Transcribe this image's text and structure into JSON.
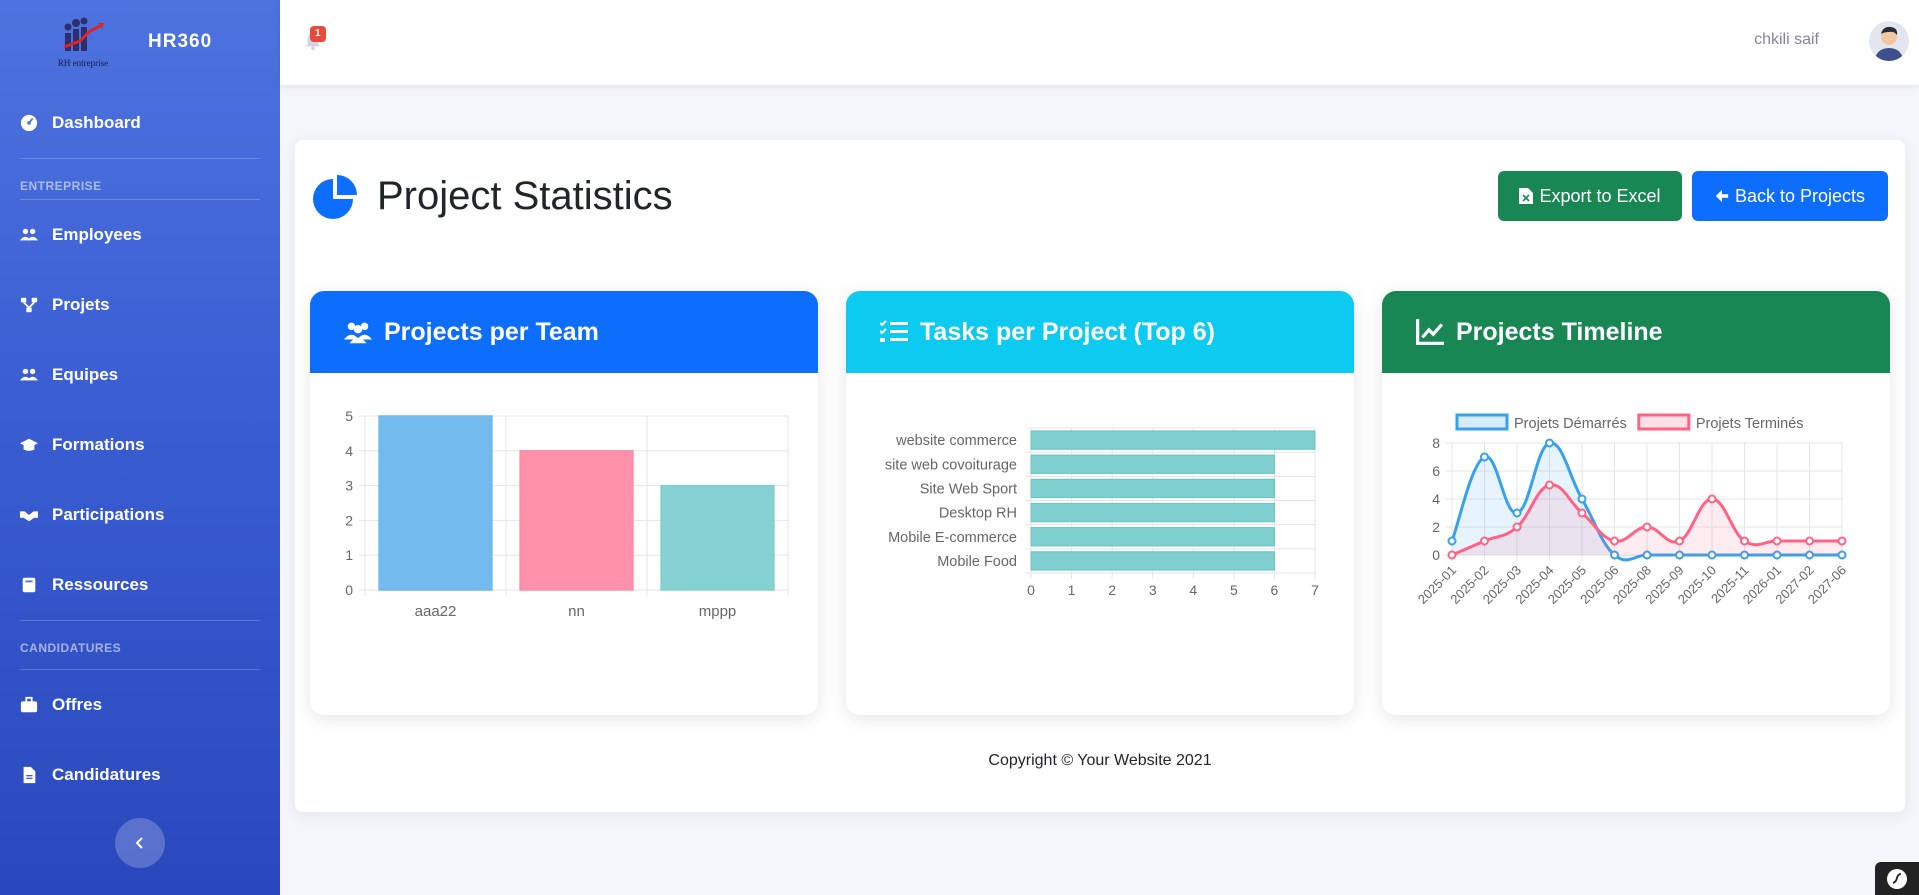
{
  "sidebar": {
    "brand": "HR360",
    "logo_text": "RH entreprise",
    "sections": [
      "ENTREPRISE",
      "CANDIDATURES"
    ],
    "items": [
      {
        "label": "Dashboard",
        "icon": "tachometer-icon"
      },
      {
        "label": "Employees",
        "icon": "users-icon"
      },
      {
        "label": "Projets",
        "icon": "sitemap-icon"
      },
      {
        "label": "Equipes",
        "icon": "users-icon"
      },
      {
        "label": "Formations",
        "icon": "graduation-cap-icon"
      },
      {
        "label": "Participations",
        "icon": "handshake-icon"
      },
      {
        "label": "Ressources",
        "icon": "book-icon"
      },
      {
        "label": "Offres",
        "icon": "briefcase-icon"
      },
      {
        "label": "Candidatures",
        "icon": "file-icon"
      }
    ]
  },
  "topbar": {
    "notification_count": "1",
    "user_name": "chkili saif"
  },
  "page": {
    "title": "Project Statistics",
    "export_label": "Export to Excel",
    "back_label": "Back to Projects",
    "footer": "Copyright © Your Website 2021"
  },
  "colors": {
    "primary": "#0d6efd",
    "info": "#0dcaf0",
    "success": "#198754",
    "sidebar": "#4e73df"
  },
  "chart_data": [
    {
      "type": "bar",
      "title": "Projects per Team",
      "categories": [
        "aaa22",
        "nn",
        "mppp"
      ],
      "values": [
        5,
        4,
        3
      ],
      "colors": [
        "#6db7ec",
        "#ff8ca5",
        "#7fcfcf"
      ],
      "ylim": [
        0,
        5
      ],
      "yticks": [
        0,
        1,
        2,
        3,
        4,
        5
      ],
      "grid": true
    },
    {
      "type": "bar",
      "orientation": "horizontal",
      "title": "Tasks per Project (Top 6)",
      "categories": [
        "website commerce",
        "site web covoiturage",
        "Site Web Sport",
        "Desktop RH",
        "Mobile E-commerce",
        "Mobile Food"
      ],
      "values": [
        7,
        6,
        6,
        6,
        6,
        6
      ],
      "xlim": [
        0,
        7
      ],
      "xticks": [
        0,
        1,
        2,
        3,
        4,
        5,
        6,
        7
      ],
      "grid": true
    },
    {
      "type": "line",
      "title": "Projects Timeline",
      "x": [
        "2025-01",
        "2025-02",
        "2025-03",
        "2025-04",
        "2025-05",
        "2025-06",
        "2025-08",
        "2025-09",
        "2025-10",
        "2025-11",
        "2026-01",
        "2027-02",
        "2027-06"
      ],
      "series": [
        {
          "name": "Projets Démarrés",
          "values": [
            1,
            7,
            3,
            8,
            4,
            0,
            0,
            0,
            0,
            0,
            0,
            0,
            0
          ],
          "color": "#36a2eb"
        },
        {
          "name": "Projets Terminés",
          "values": [
            0,
            1,
            2,
            5,
            3,
            1,
            2,
            1,
            4,
            1,
            1,
            1,
            1
          ],
          "color": "#ff6384"
        }
      ],
      "ylim": [
        0,
        8
      ],
      "yticks": [
        0,
        2,
        4,
        6,
        8
      ],
      "legend": "top",
      "grid": true
    }
  ]
}
